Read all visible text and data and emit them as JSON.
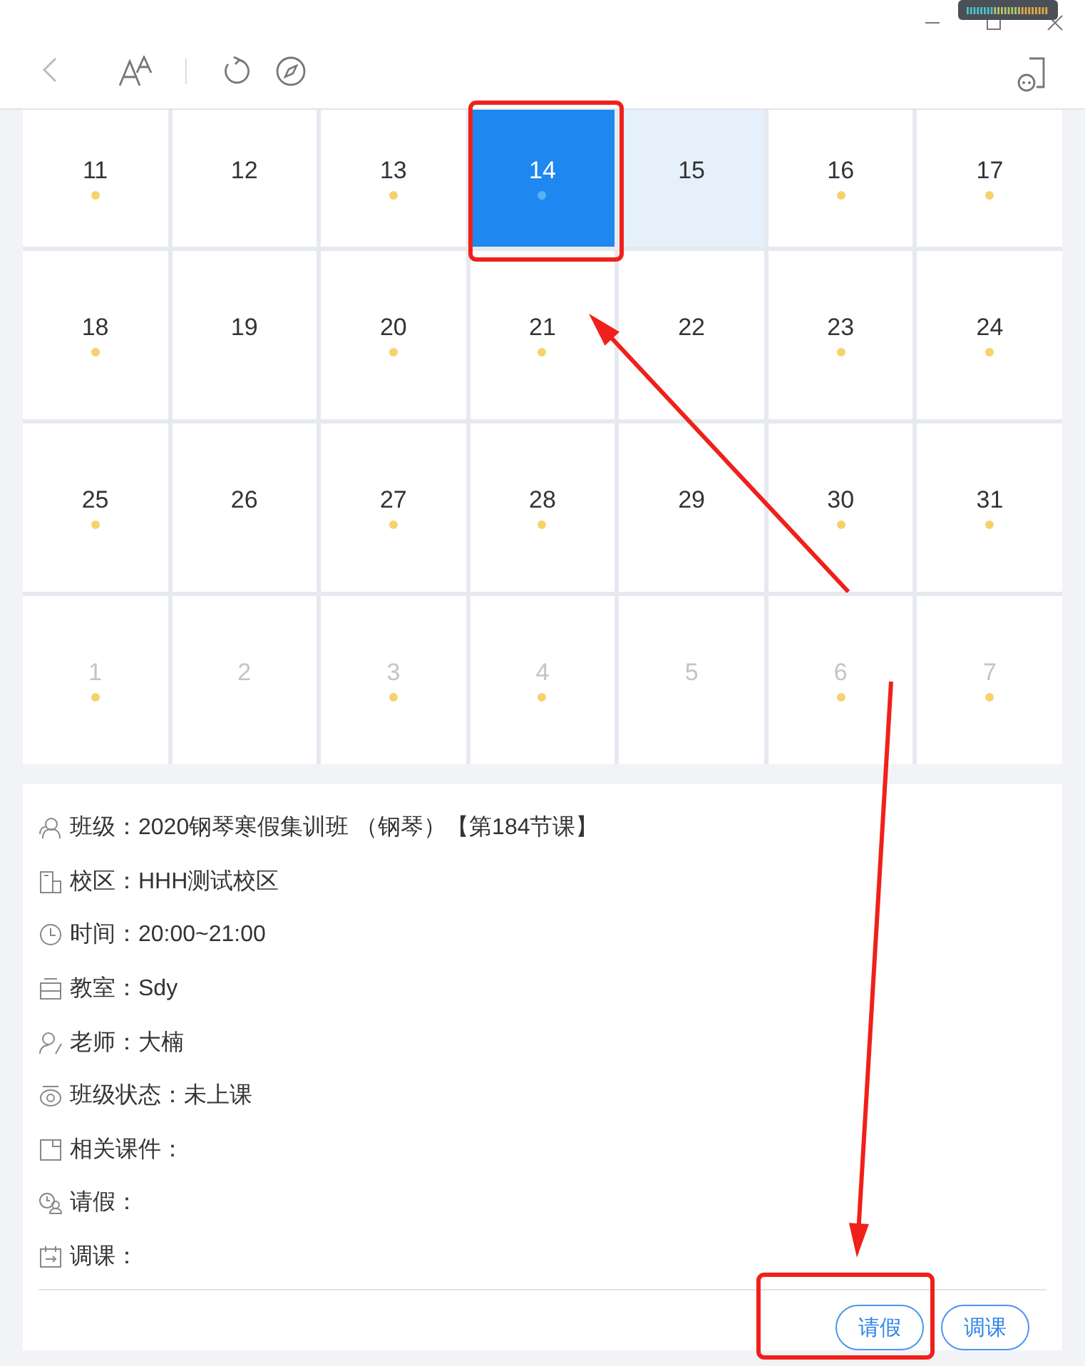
{
  "calendar": {
    "days": [
      {
        "day": "11",
        "has_class": true,
        "other_month": false,
        "selected": false,
        "today": false
      },
      {
        "day": "12",
        "has_class": false,
        "other_month": false,
        "selected": false,
        "today": false
      },
      {
        "day": "13",
        "has_class": true,
        "other_month": false,
        "selected": false,
        "today": false
      },
      {
        "day": "14",
        "has_class": true,
        "other_month": false,
        "selected": true,
        "today": false
      },
      {
        "day": "15",
        "has_class": false,
        "other_month": false,
        "selected": false,
        "today": true
      },
      {
        "day": "16",
        "has_class": true,
        "other_month": false,
        "selected": false,
        "today": false
      },
      {
        "day": "17",
        "has_class": true,
        "other_month": false,
        "selected": false,
        "today": false
      },
      {
        "day": "18",
        "has_class": true,
        "other_month": false,
        "selected": false,
        "today": false
      },
      {
        "day": "19",
        "has_class": false,
        "other_month": false,
        "selected": false,
        "today": false
      },
      {
        "day": "20",
        "has_class": true,
        "other_month": false,
        "selected": false,
        "today": false
      },
      {
        "day": "21",
        "has_class": true,
        "other_month": false,
        "selected": false,
        "today": false
      },
      {
        "day": "22",
        "has_class": false,
        "other_month": false,
        "selected": false,
        "today": false
      },
      {
        "day": "23",
        "has_class": true,
        "other_month": false,
        "selected": false,
        "today": false
      },
      {
        "day": "24",
        "has_class": true,
        "other_month": false,
        "selected": false,
        "today": false
      },
      {
        "day": "25",
        "has_class": true,
        "other_month": false,
        "selected": false,
        "today": false
      },
      {
        "day": "26",
        "has_class": false,
        "other_month": false,
        "selected": false,
        "today": false
      },
      {
        "day": "27",
        "has_class": true,
        "other_month": false,
        "selected": false,
        "today": false
      },
      {
        "day": "28",
        "has_class": true,
        "other_month": false,
        "selected": false,
        "today": false
      },
      {
        "day": "29",
        "has_class": false,
        "other_month": false,
        "selected": false,
        "today": false
      },
      {
        "day": "30",
        "has_class": true,
        "other_month": false,
        "selected": false,
        "today": false
      },
      {
        "day": "31",
        "has_class": true,
        "other_month": false,
        "selected": false,
        "today": false
      },
      {
        "day": "1",
        "has_class": true,
        "other_month": true,
        "selected": false,
        "today": false
      },
      {
        "day": "2",
        "has_class": false,
        "other_month": true,
        "selected": false,
        "today": false
      },
      {
        "day": "3",
        "has_class": true,
        "other_month": true,
        "selected": false,
        "today": false
      },
      {
        "day": "4",
        "has_class": true,
        "other_month": true,
        "selected": false,
        "today": false
      },
      {
        "day": "5",
        "has_class": false,
        "other_month": true,
        "selected": false,
        "today": false
      },
      {
        "day": "6",
        "has_class": true,
        "other_month": true,
        "selected": false,
        "today": false
      },
      {
        "day": "7",
        "has_class": true,
        "other_month": true,
        "selected": false,
        "today": false
      }
    ]
  },
  "details": [
    {
      "kind": "class",
      "label": "班级：",
      "value": "2020钢琴寒假集训班 （钢琴）【第184节课】"
    },
    {
      "kind": "campus",
      "label": "校区：",
      "value": "HHH测试校区"
    },
    {
      "kind": "time",
      "label": "时间：",
      "value": "20:00~21:00"
    },
    {
      "kind": "room",
      "label": "教室：",
      "value": "Sdy"
    },
    {
      "kind": "teacher",
      "label": "老师：",
      "value": "大楠"
    },
    {
      "kind": "status",
      "label": "班级状态：",
      "value": "未上课"
    },
    {
      "kind": "files",
      "label": "相关课件："
    },
    {
      "kind": "leave",
      "label": "请假："
    },
    {
      "kind": "reschedule",
      "label": "调课："
    }
  ],
  "buttons": [
    "请假",
    "调课"
  ],
  "annotations": [
    {
      "kind": "box"
    },
    {
      "kind": "arrow"
    },
    {
      "kind": "arrow"
    },
    {
      "kind": "box"
    }
  ]
}
